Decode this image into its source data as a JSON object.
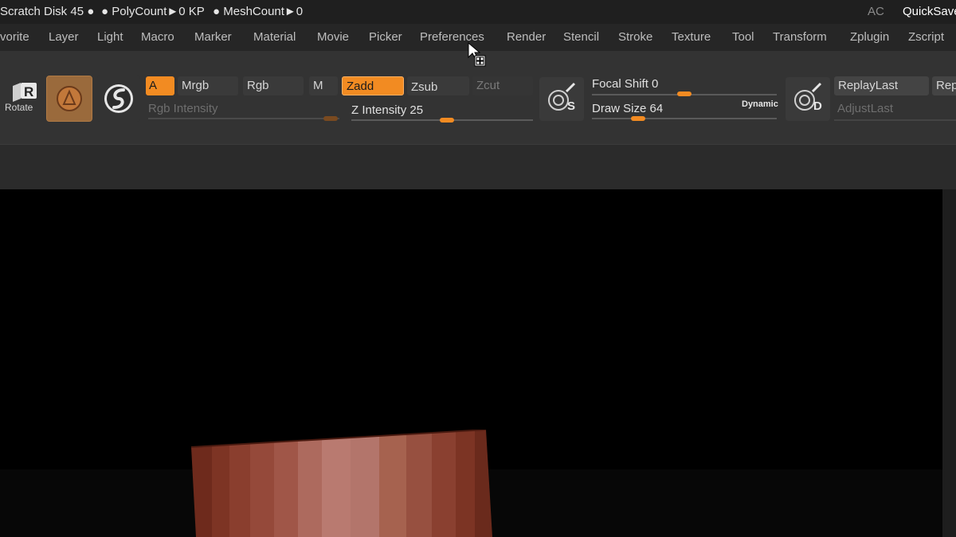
{
  "statusbar": {
    "scratch_disk": "Scratch Disk 45 ●",
    "polycount": "● PolyCount►0 KP",
    "meshcount": "● MeshCount►0",
    "ac": "AC",
    "quicksave": "QuickSave"
  },
  "menu": {
    "items": [
      "vorite",
      "Layer",
      "Light",
      "Macro",
      "Marker",
      "Material",
      "Movie",
      "Picker",
      "Preferences",
      "Render",
      "Stencil",
      "Stroke",
      "Texture",
      "Tool",
      "Transform",
      "Zplugin",
      "Zscript"
    ]
  },
  "shelf": {
    "rotate_label": "Rotate",
    "rotate_letter": "R",
    "a_label": "A",
    "mrgb_label": "Mrgb",
    "rgb_label": "Rgb",
    "m_label": "M",
    "zadd_label": "Zadd",
    "zsub_label": "Zsub",
    "zcut_label": "Zcut",
    "rgb_intensity_label": "Rgb Intensity",
    "z_intensity_label": "Z Intensity 25",
    "focal_shift_label": "Focal Shift 0",
    "draw_size_label": "Draw Size 64",
    "dynamic_label": "Dynamic",
    "replaylast_label": "ReplayLast",
    "rep_label": "Rep",
    "adjustlast_label": "AdjustLast",
    "s_letter": "S",
    "d_letter": "D",
    "z_intensity_value": 25,
    "focal_shift_value": 0,
    "draw_size_value": 64
  },
  "colors": {
    "accent": "#f28b22",
    "mesh": "#9a4a38",
    "background": "#2a2a2a",
    "viewport": "#000000"
  }
}
